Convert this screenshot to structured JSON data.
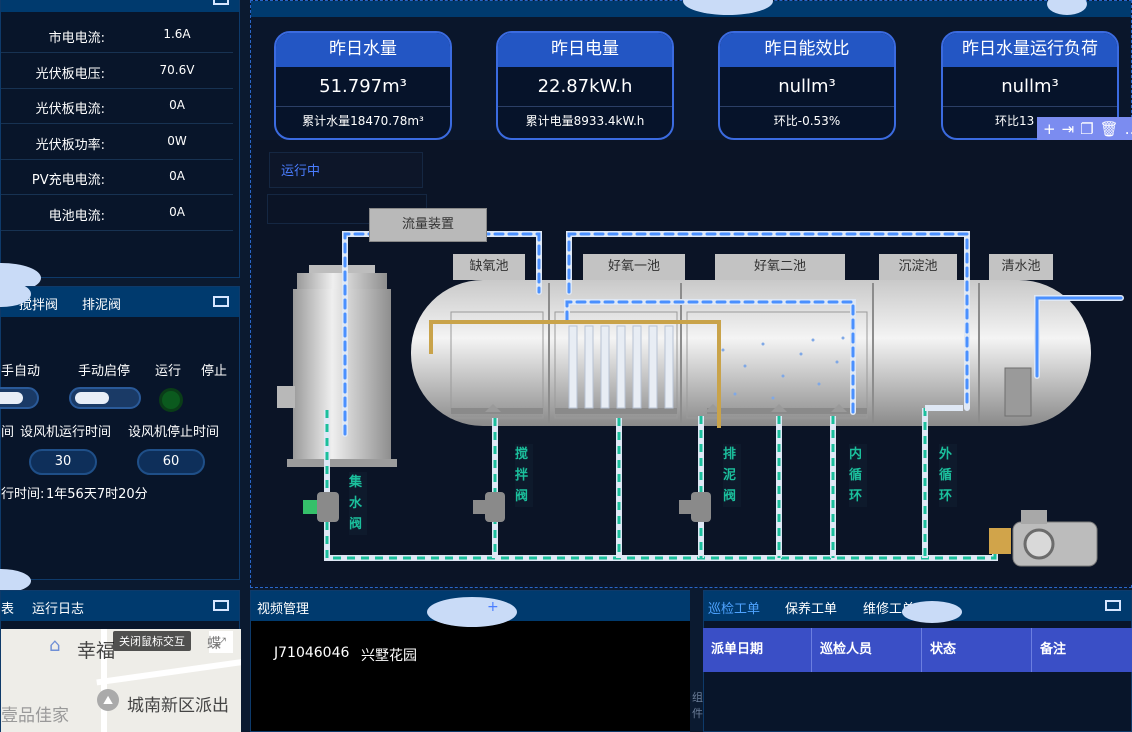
{
  "left_top": {
    "rows": [
      {
        "label": "市电电流:",
        "value": "1.6A"
      },
      {
        "label": "光伏板电压:",
        "value": "70.6V"
      },
      {
        "label": "光伏板电流:",
        "value": "0A"
      },
      {
        "label": "光伏板功率:",
        "value": "0W"
      },
      {
        "label": "PV充电电流:",
        "value": "0A"
      },
      {
        "label": "电池电流:",
        "value": "0A"
      }
    ]
  },
  "valve_panel": {
    "tabs": [
      "搅拌阀",
      "排泥阀"
    ],
    "header_auto": "手自动",
    "header_manual": "手动启停",
    "header_run": "运行",
    "header_stop": "停止",
    "fan_run_partial": "间",
    "fan_run_label": "设风机运行时间",
    "fan_stop_label": "设风机停止时间",
    "fan_run_value": "30",
    "fan_stop_value": "60",
    "runtime_label": "行时间:",
    "runtime_value": "1年56天7时20分"
  },
  "cards": [
    {
      "title": "昨日水量",
      "value": "51.797m³",
      "sub": "累计水量18470.78m³"
    },
    {
      "title": "昨日电量",
      "value": "22.87kW.h",
      "sub": "累计电量8933.4kW.h"
    },
    {
      "title": "昨日能效比",
      "value": "nullm³",
      "sub": "环比-0.53%"
    },
    {
      "title": "昨日水量运行负荷",
      "value": "nullm³",
      "sub": "环比13"
    }
  ],
  "scene": {
    "status": "运行中",
    "flow_device": "流量装置",
    "tanks": [
      "缺氧池",
      "好氧一池",
      "好氧二池",
      "沉淀池",
      "清水池"
    ],
    "valves": [
      "集水阀",
      "搅拌阀",
      "排泥阀",
      "内循环",
      "外循环"
    ]
  },
  "bottom_left": {
    "tabs": [
      "表",
      "运行日志"
    ],
    "map_button": "关闭鼠标交互",
    "map_labels": [
      "幸福",
      "城南新区派出",
      "壹品佳家",
      "蝶"
    ]
  },
  "video": {
    "title": "视频管理",
    "device": "J71046046",
    "location": "兴墅花园",
    "side_text": "组件"
  },
  "workorders": {
    "tabs": [
      "巡检工单",
      "保养工单",
      "维修工单"
    ],
    "columns": [
      "派单日期",
      "巡检人员",
      "状态",
      "备注"
    ]
  },
  "colors": {
    "accent": "#3b6be0",
    "panel_head": "#003a6e",
    "pipe_green": "#1bbf9c",
    "pipe_blue": "#4a90ff"
  }
}
